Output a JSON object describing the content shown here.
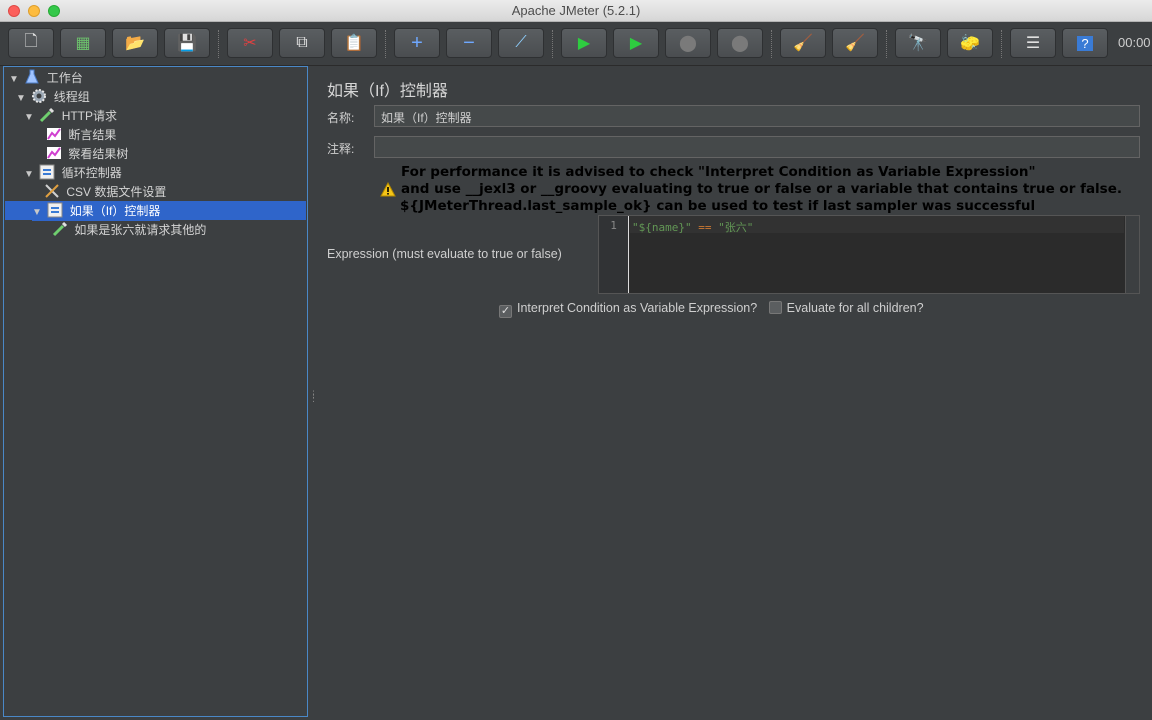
{
  "window": {
    "title": "Apache JMeter (5.2.1)"
  },
  "toolbar": {
    "timer": "00:00",
    "buttons": [
      {
        "name": "new-icon",
        "glyph": "🗋"
      },
      {
        "name": "templates-icon",
        "glyph": "▦"
      },
      {
        "name": "open-icon",
        "glyph": "📂"
      },
      {
        "name": "save-icon",
        "glyph": "💾"
      },
      {
        "name": "cut-icon",
        "glyph": "✂"
      },
      {
        "name": "copy-icon",
        "glyph": "⧉"
      },
      {
        "name": "paste-icon",
        "glyph": "📋"
      },
      {
        "name": "expand-icon",
        "glyph": "+"
      },
      {
        "name": "collapse-icon",
        "glyph": "−"
      },
      {
        "name": "toggle-icon",
        "glyph": "⟋"
      },
      {
        "name": "start-icon",
        "glyph": "▶"
      },
      {
        "name": "start-no-pause-icon",
        "glyph": "▶"
      },
      {
        "name": "stop-icon",
        "glyph": "⬤"
      },
      {
        "name": "shutdown-icon",
        "glyph": "⬤"
      },
      {
        "name": "clear-icon",
        "glyph": "🧹"
      },
      {
        "name": "clear-all-icon",
        "glyph": "🧹"
      },
      {
        "name": "search-icon",
        "glyph": "🔭"
      },
      {
        "name": "reset-search-icon",
        "glyph": "🧽"
      },
      {
        "name": "function-helper-icon",
        "glyph": "☰"
      },
      {
        "name": "help-icon",
        "glyph": "?"
      }
    ]
  },
  "tree": {
    "nodes": [
      {
        "label": "工作台",
        "icon": "flask-icon",
        "toggle": "▼"
      },
      {
        "label": "线程组",
        "icon": "gear-icon",
        "toggle": "▼"
      },
      {
        "label": "HTTP请求",
        "icon": "pipette-icon",
        "toggle": "▼"
      },
      {
        "label": "断言结果",
        "icon": "chart-icon",
        "toggle": ""
      },
      {
        "label": "察看结果树",
        "icon": "chart-icon",
        "toggle": ""
      },
      {
        "label": "循环控制器",
        "icon": "controller-icon",
        "toggle": "▼"
      },
      {
        "label": "CSV 数据文件设置",
        "icon": "tools-icon",
        "toggle": ""
      },
      {
        "label": "如果（If）控制器",
        "icon": "controller-icon",
        "toggle": "▼"
      },
      {
        "label": "如果是张六就请求其他的",
        "icon": "pipette-icon",
        "toggle": ""
      }
    ]
  },
  "panel": {
    "title": "如果（If）控制器",
    "name_label": "名称:",
    "name_value": "如果（If）控制器",
    "comment_label": "注释:",
    "comment_value": "",
    "warning": {
      "line1": "For performance it is advised to check \"Interpret Condition as Variable Expression\"",
      "line2": "and use __jexl3 or __groovy evaluating to true or false or a variable that contains true or false.",
      "line3": "${JMeterThread.last_sample_ok} can be used to test if last sampler was successful"
    },
    "expression_label": "Expression (must evaluate to true or false)",
    "editor": {
      "line_number": "1",
      "code_left": "\"${name}\"",
      "code_op": " == ",
      "code_right": "\"张六\""
    },
    "checkbox_interpret": {
      "label": "Interpret Condition as Variable Expression?",
      "checked": true,
      "mark": "✓"
    },
    "checkbox_children": {
      "label": "Evaluate for all children?",
      "checked": false,
      "mark": ""
    }
  }
}
